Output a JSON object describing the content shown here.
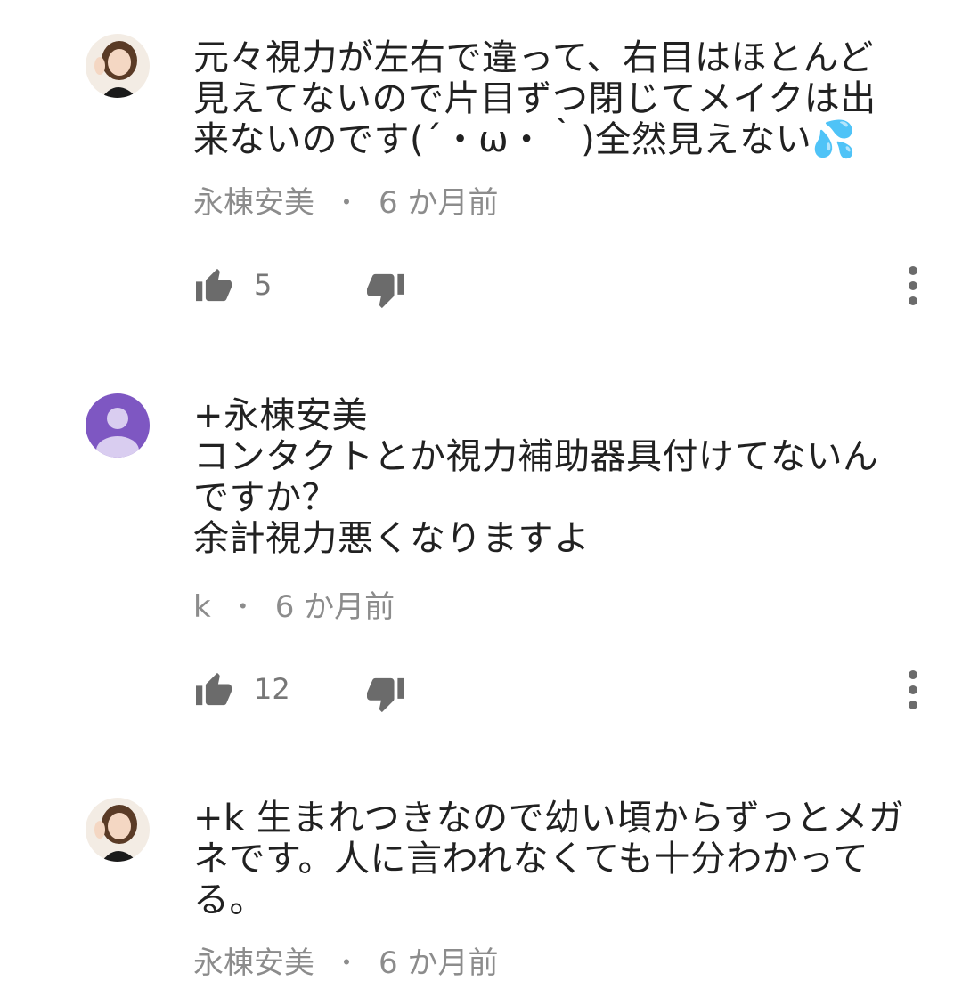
{
  "comments": [
    {
      "author": "永棟安美",
      "avatar_icon": "user-photo-avatar",
      "text": "元々視力が左右で違って、右目はほとんど\n見えてないので片目ずつ閉じてメイクは出\n来ないのです(´・ω・｀)全然見えない💦",
      "age": "6 か月前",
      "likes": "5"
    },
    {
      "author": "k",
      "avatar_icon": "default-user-avatar",
      "avatar_color": "#7e57c2",
      "text": "+永棟安美\nコンタクトとか視力補助器具付けてないん\nですか？\n余計視力悪くなりますよ",
      "age": "6 か月前",
      "likes": "12"
    },
    {
      "author": "永棟安美",
      "avatar_icon": "user-photo-avatar",
      "text": "+k 生まれつきなので幼い頃からずっとメガ\nネです。人に言われなくても十分わかって\nる。",
      "age": "6 か月前"
    }
  ],
  "icons": {
    "like": "thumb-up-icon",
    "dislike": "thumb-down-icon",
    "menu": "more-vert-icon"
  },
  "colors": {
    "text": "#212121",
    "meta": "#8c8c8c",
    "icon": "#6b6b6b",
    "default_avatar": "#7e57c2"
  },
  "separator": "・"
}
